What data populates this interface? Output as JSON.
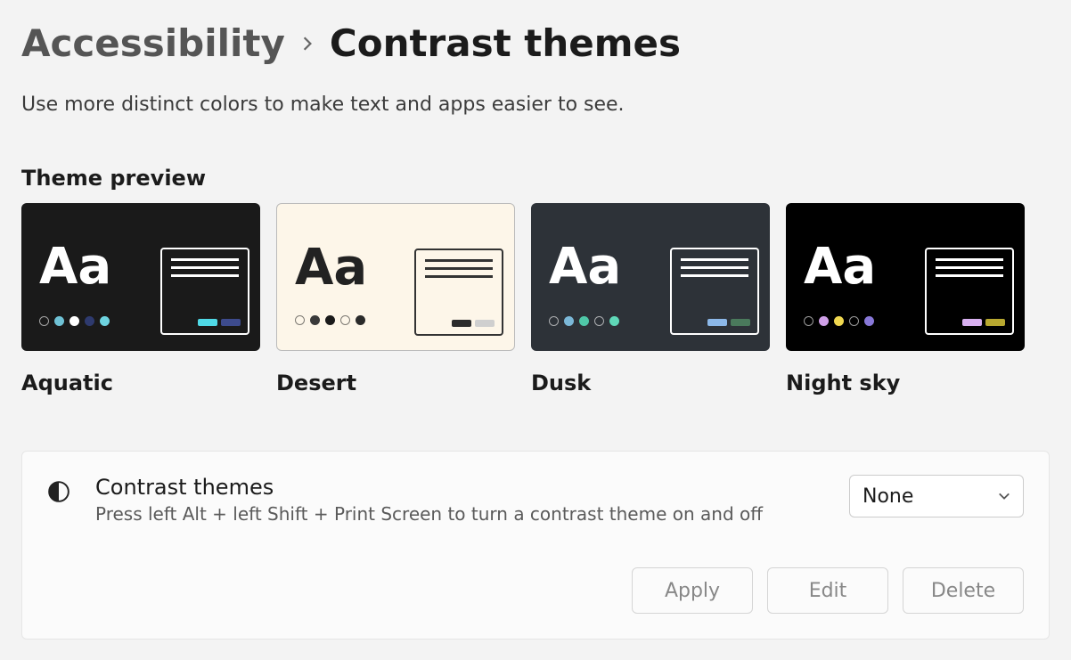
{
  "breadcrumb": {
    "parent": "Accessibility",
    "current": "Contrast themes"
  },
  "description": "Use more distinct colors to make text and apps easier to see.",
  "section_heading": "Theme preview",
  "themes": [
    {
      "name": "Aquatic",
      "bg": "dark",
      "text": "white",
      "panel_border": "dark-border",
      "panel_line": "",
      "dots": [
        {
          "cls": "outline",
          "color": ""
        },
        {
          "cls": "",
          "color": "#6fc2d6"
        },
        {
          "cls": "",
          "color": "#fff"
        },
        {
          "cls": "",
          "color": "#2e3a6e"
        },
        {
          "cls": "",
          "color": "#6ed4e0"
        }
      ],
      "btns": [
        "#4fd9e6",
        "#3d4b8d"
      ]
    },
    {
      "name": "Desert",
      "bg": "light",
      "text": "blackc",
      "panel_border": "light-border",
      "panel_line": "dark",
      "dots": [
        {
          "cls": "outline-dark",
          "color": ""
        },
        {
          "cls": "",
          "color": "#3a3a3a"
        },
        {
          "cls": "",
          "color": "#1a1a1a"
        },
        {
          "cls": "outline-dark",
          "color": ""
        },
        {
          "cls": "",
          "color": "#2a2a2a"
        }
      ],
      "btns": [
        "#2c2c2c",
        "#cfcfcf"
      ]
    },
    {
      "name": "Dusk",
      "bg": "darkgrey",
      "text": "white",
      "panel_border": "dark-border",
      "panel_line": "",
      "dots": [
        {
          "cls": "outline",
          "color": ""
        },
        {
          "cls": "",
          "color": "#7bb8d8"
        },
        {
          "cls": "",
          "color": "#4fc8a8"
        },
        {
          "cls": "outline",
          "color": ""
        },
        {
          "cls": "",
          "color": "#5fd8b8"
        }
      ],
      "btns": [
        "#8cb8e8",
        "#4a7a5c"
      ]
    },
    {
      "name": "Night sky",
      "bg": "black",
      "text": "white",
      "panel_border": "dark-border",
      "panel_line": "",
      "dots": [
        {
          "cls": "outline",
          "color": ""
        },
        {
          "cls": "",
          "color": "#d0a0e8"
        },
        {
          "cls": "",
          "color": "#f0d850"
        },
        {
          "cls": "outline",
          "color": ""
        },
        {
          "cls": "",
          "color": "#8878d8"
        }
      ],
      "btns": [
        "#d8b0f0",
        "#b8a830"
      ]
    }
  ],
  "card": {
    "title": "Contrast themes",
    "subtitle": "Press left Alt + left Shift + Print Screen to turn a contrast theme on and off",
    "dropdown_value": "None",
    "buttons": {
      "apply": "Apply",
      "edit": "Edit",
      "delete": "Delete"
    }
  }
}
